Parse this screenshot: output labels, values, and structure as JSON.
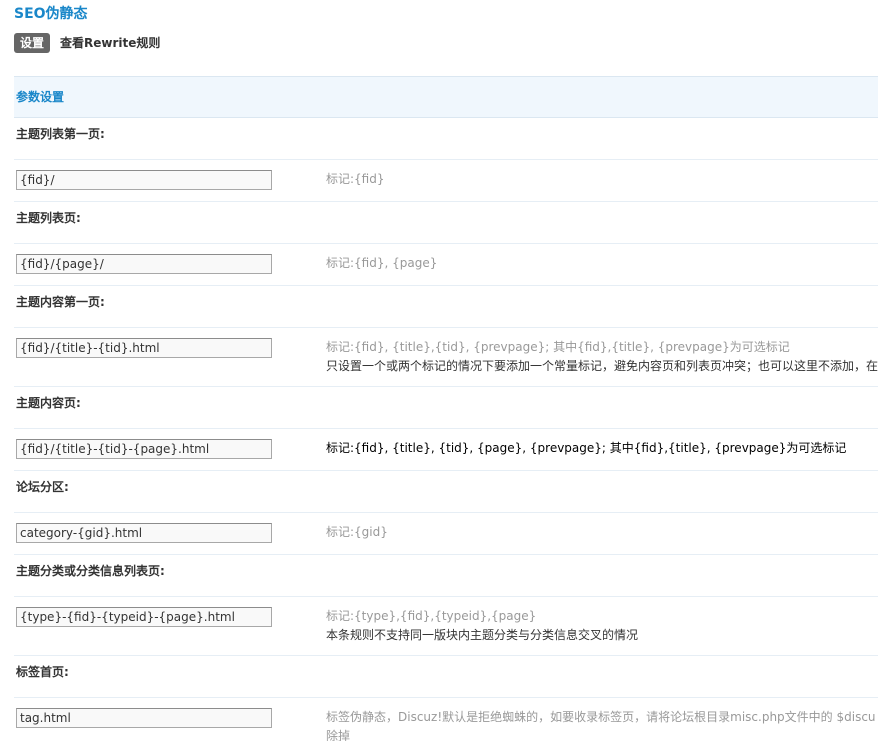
{
  "page": {
    "title": "SEO伪静态"
  },
  "tabs": [
    {
      "label": "设置",
      "active": true
    },
    {
      "label": "查看Rewrite规则",
      "active": false
    }
  ],
  "section": {
    "title": "参数设置"
  },
  "rules": [
    {
      "label": "主题列表第一页:",
      "value": "{fid}/",
      "hint": "标记:{fid}",
      "hint2": ""
    },
    {
      "label": "主题列表页:",
      "value": "{fid}/{page}/",
      "hint": "标记:{fid}, {page}",
      "hint2": ""
    },
    {
      "label": "主题内容第一页:",
      "value": "{fid}/{title}-{tid}.html",
      "hint": "标记:{fid}, {title},{tid}, {prevpage}; 其中{fid},{title}, {prevpage}为可选标记",
      "hint2": "只设置一个或两个标记的情况下要添加一个常量标记，避免内容页和列表页冲突；也可以这里不添加，在"
    },
    {
      "label": "主题内容页:",
      "value": "{fid}/{title}-{tid}-{page}.html",
      "hint": "标记:{fid}, {title}, {tid}, {page}, {prevpage}; 其中{fid},{title}, {prevpage}为可选标记",
      "hint2": ""
    },
    {
      "label": "论坛分区:",
      "value": "category-{gid}.html",
      "hint": "标记:{gid}",
      "hint2": ""
    },
    {
      "label": "主题分类或分类信息列表页:",
      "value": "{type}-{fid}-{typeid}-{page}.html",
      "hint": "标记:{type},{fid},{typeid},{page}",
      "hint2": "本条规则不支持同一版块内主题分类与分类信息交叉的情况"
    },
    {
      "label": "标签首页:",
      "value": "tag.html",
      "hint": "标签伪静态，Discuz!默认是拒绝蜘蛛的，如要收录标签页，请将论坛根目录misc.php文件中的 $discu",
      "hint2": "除掉"
    }
  ],
  "colors": {
    "accent": "#1a87c9",
    "section_bg": "#f0f7fd",
    "hint": "#999999",
    "tab_active_bg": "#666666"
  }
}
